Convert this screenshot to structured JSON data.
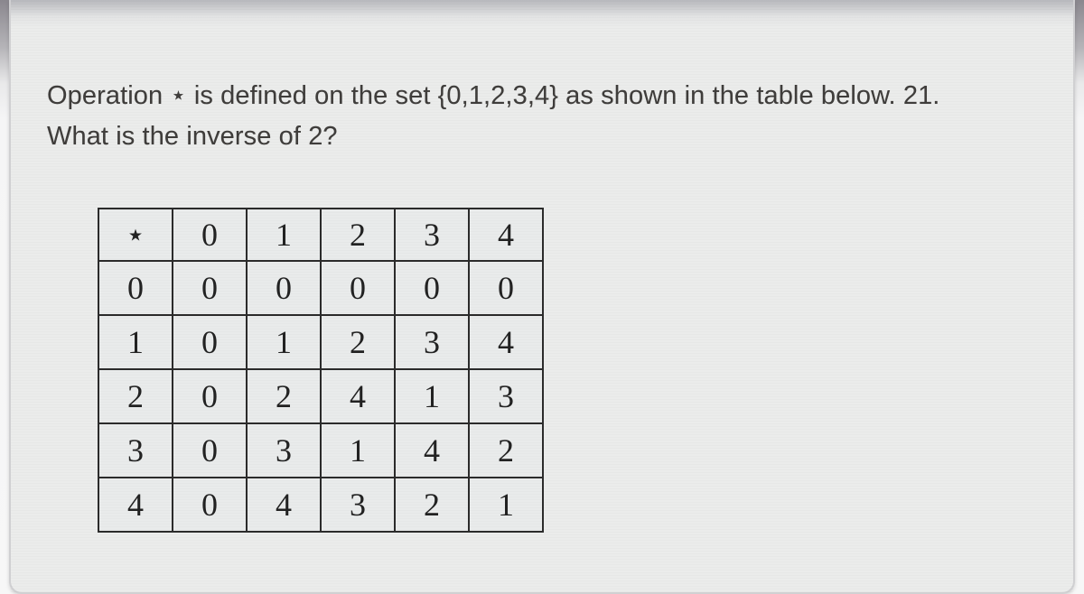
{
  "question": {
    "line1": "Operation ⋆ is defined on the set {0,1,2,3,4} as shown in the table below. 21.",
    "line2": "What is the inverse of 2?"
  },
  "table": {
    "symbol": "⋆",
    "col_headers": [
      "0",
      "1",
      "2",
      "3",
      "4"
    ],
    "row_headers": [
      "0",
      "1",
      "2",
      "3",
      "4"
    ],
    "cells": [
      [
        "0",
        "0",
        "0",
        "0",
        "0"
      ],
      [
        "0",
        "1",
        "2",
        "3",
        "4"
      ],
      [
        "0",
        "2",
        "4",
        "1",
        "3"
      ],
      [
        "0",
        "3",
        "1",
        "4",
        "2"
      ],
      [
        "0",
        "4",
        "3",
        "2",
        "1"
      ]
    ]
  }
}
